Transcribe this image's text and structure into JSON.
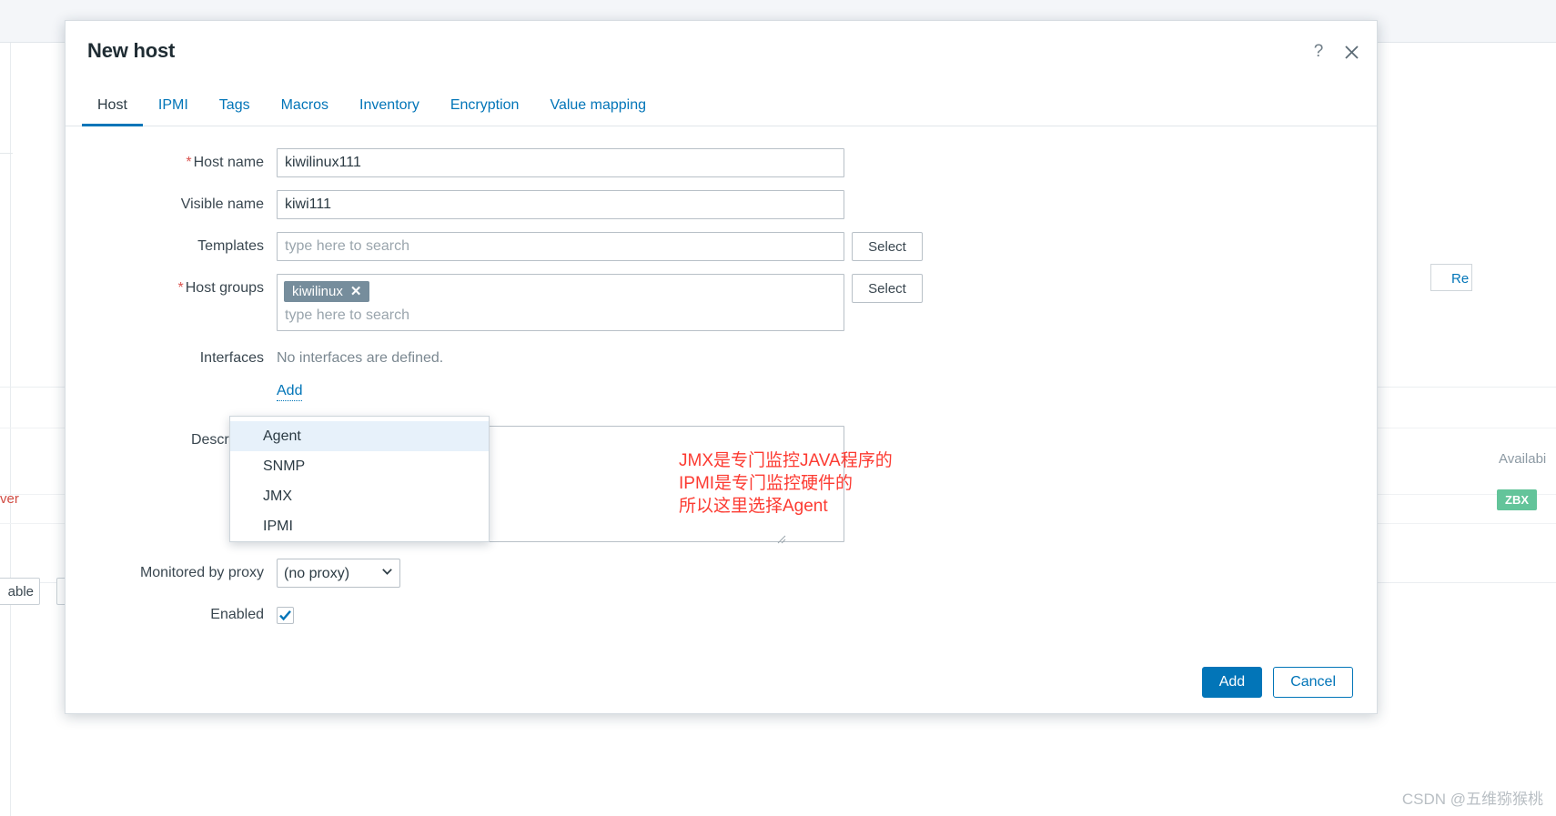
{
  "modal": {
    "title": "New host",
    "help_icon_label": "?",
    "tabs": [
      {
        "label": "Host",
        "active": true
      },
      {
        "label": "IPMI",
        "active": false
      },
      {
        "label": "Tags",
        "active": false
      },
      {
        "label": "Macros",
        "active": false
      },
      {
        "label": "Inventory",
        "active": false
      },
      {
        "label": "Encryption",
        "active": false
      },
      {
        "label": "Value mapping",
        "active": false
      }
    ],
    "fields": {
      "host_name": {
        "label": "Host name",
        "required": true,
        "value": "kiwilinux111",
        "placeholder": ""
      },
      "visible_name": {
        "label": "Visible name",
        "required": false,
        "value": "kiwi111",
        "placeholder": ""
      },
      "templates": {
        "label": "Templates",
        "required": false,
        "value": "",
        "placeholder": "type here to search",
        "select_button": "Select"
      },
      "host_groups": {
        "label": "Host groups",
        "required": true,
        "chips": [
          {
            "label": "kiwilinux",
            "remove": "✕"
          }
        ],
        "placeholder": "type here to search",
        "select_button": "Select"
      },
      "interfaces": {
        "label": "Interfaces",
        "empty_text": "No interfaces are defined.",
        "add_link": "Add"
      },
      "description": {
        "label": "Description",
        "value": "",
        "placeholder": ""
      },
      "monitored_by_proxy": {
        "label": "Monitored by proxy",
        "value": "(no proxy)",
        "options": [
          "(no proxy)"
        ]
      },
      "enabled": {
        "label": "Enabled",
        "checked": true
      }
    },
    "interface_dropdown": {
      "items": [
        {
          "label": "Agent",
          "highlighted": true
        },
        {
          "label": "SNMP",
          "highlighted": false
        },
        {
          "label": "JMX",
          "highlighted": false
        },
        {
          "label": "IPMI",
          "highlighted": false
        }
      ]
    },
    "footer": {
      "add_button": "Add",
      "cancel_button": "Cancel"
    }
  },
  "annotation": {
    "color": "#fc3b32",
    "lines": [
      "JMX是专门监控JAVA程序的",
      "IPMI是专门监控硬件的",
      "所以这里选择Agent"
    ]
  },
  "background": {
    "right_link": "Re",
    "availability_text": "Availabi",
    "server_text": "ver",
    "zbx_badge": "ZBX",
    "able_button": "able"
  },
  "watermark": "CSDN @五维猕猴桃",
  "colors": {
    "accent": "#0275b8",
    "required": "#d9534f",
    "chip_bg": "#768d9c",
    "annotation": "#fc3b32",
    "zbx_green": "#63c49a"
  }
}
